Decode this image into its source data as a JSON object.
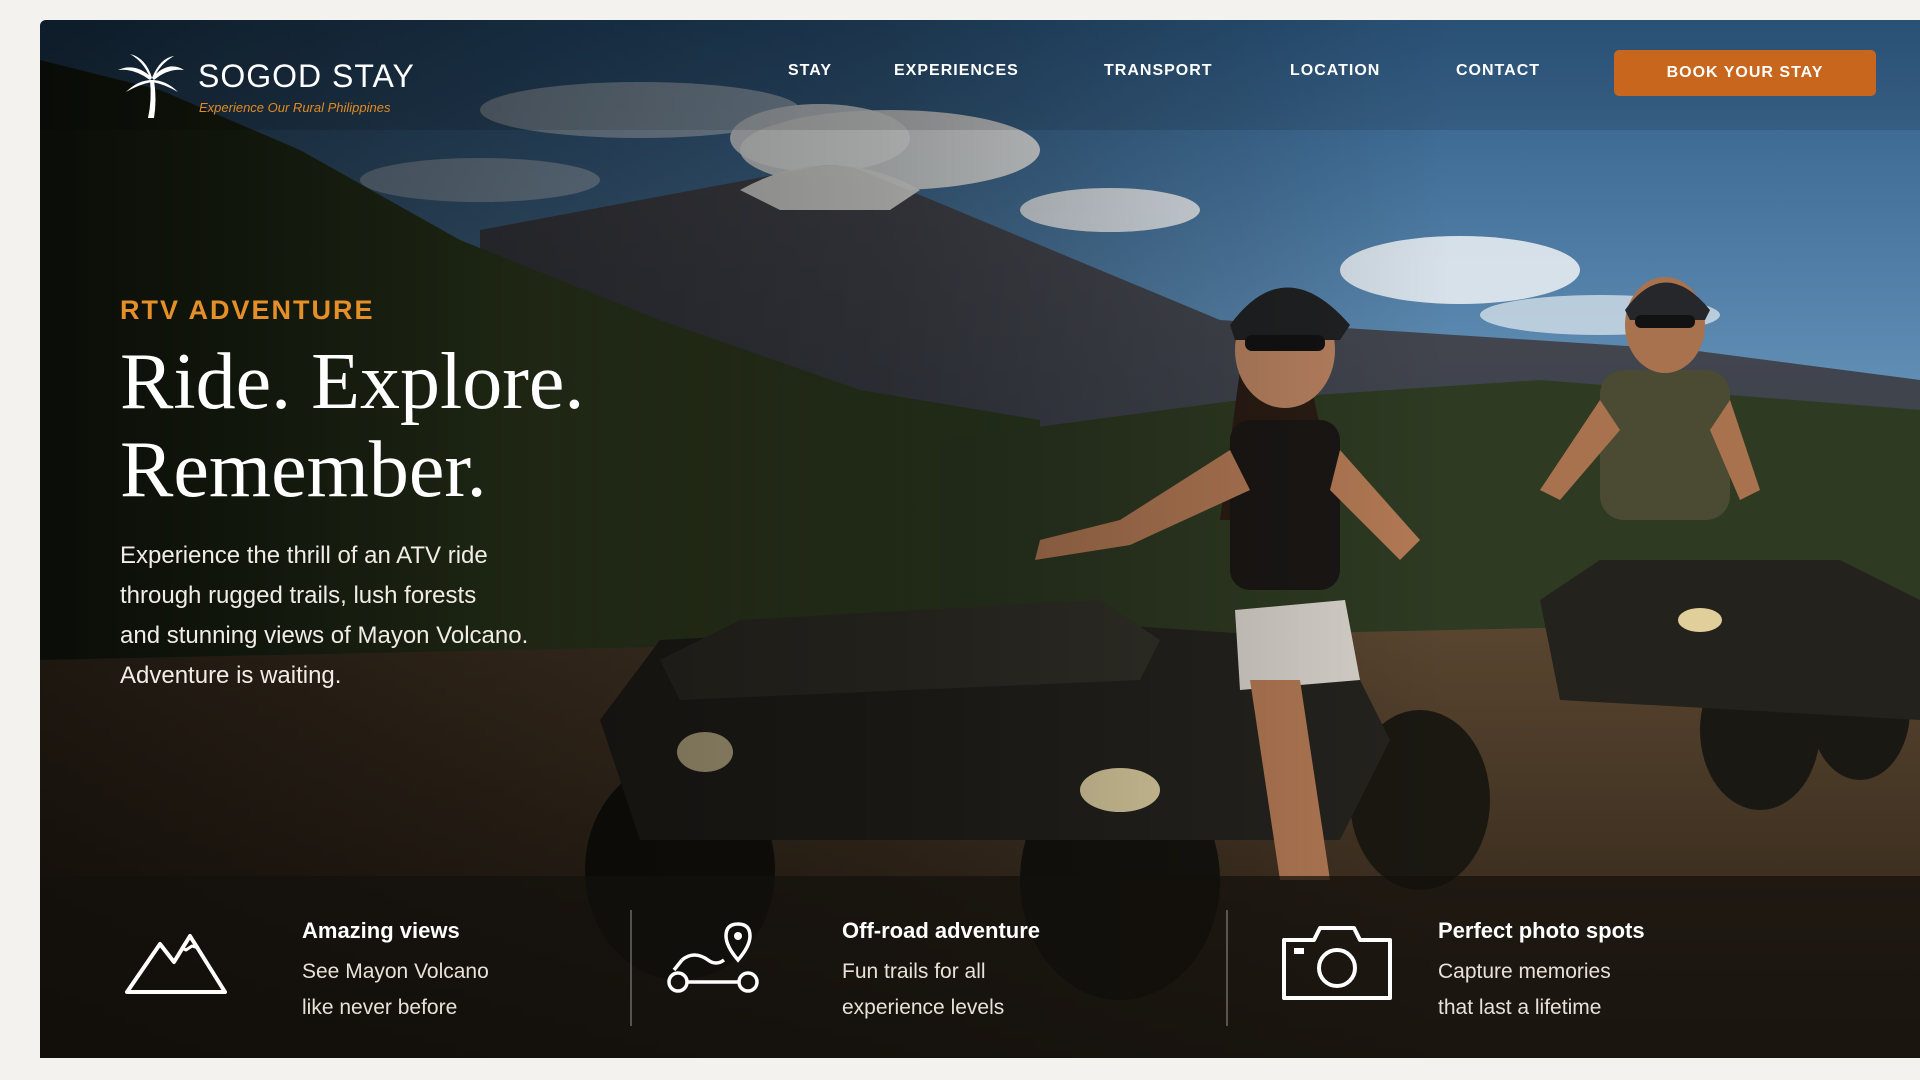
{
  "brand": {
    "name": "SOGOD STAY",
    "tagline": "Experience Our Rural Philippines"
  },
  "nav": {
    "items": [
      "STAY",
      "EXPERIENCES",
      "TRANSPORT",
      "LOCATION",
      "CONTACT"
    ],
    "cta": "BOOK YOUR STAY"
  },
  "hero": {
    "kicker": "RTV ADVENTURE",
    "headline_line1": "Ride. Explore.",
    "headline_line2": "Remember.",
    "body_line1": "Experience the thrill of an ATV ride",
    "body_line2": "through rugged trails, lush forests",
    "body_line3": "and stunning views of Mayon Volcano.",
    "body_line4": "Adventure is waiting."
  },
  "features": [
    {
      "icon": "mountain-icon",
      "title": "Amazing views",
      "desc_line1": "See Mayon Volcano",
      "desc_line2": "like never before"
    },
    {
      "icon": "route-icon",
      "title": "Off-road adventure",
      "desc_line1": "Fun trails for all",
      "desc_line2": "experience levels"
    },
    {
      "icon": "camera-icon",
      "title": "Perfect photo spots",
      "desc_line1": "Capture memories",
      "desc_line2": "that last a lifetime"
    }
  ],
  "colors": {
    "accent": "#c7661c",
    "kicker": "#e58f28",
    "feature_bar": "#14100c"
  }
}
